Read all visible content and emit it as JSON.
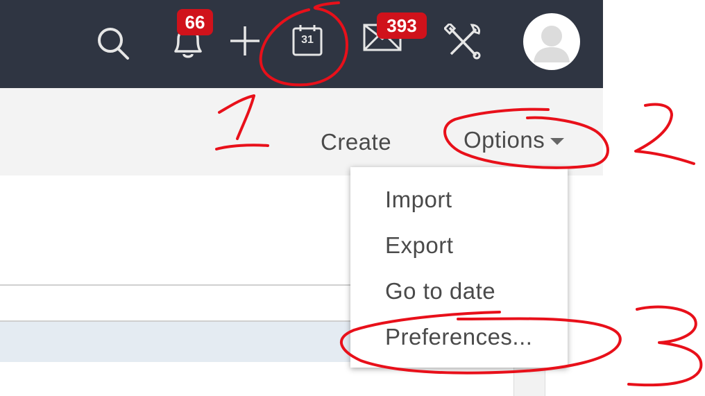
{
  "header": {
    "notifications_count": "66",
    "mail_count": "393",
    "icons": [
      "search-icon",
      "bell-icon",
      "plus-icon",
      "calendar-icon",
      "mail-icon",
      "tools-icon",
      "avatar"
    ],
    "calendar_day": "31"
  },
  "toolbar": {
    "create_label": "Create",
    "options_label": "Options"
  },
  "options_menu": {
    "items": [
      "Import",
      "Export",
      "Go to date",
      "Preferences..."
    ]
  },
  "annotations": {
    "marks": [
      "1",
      "2",
      "3"
    ],
    "color": "#e8101a"
  },
  "colors": {
    "topbar": "#2f3542",
    "badge": "#d0121b"
  }
}
